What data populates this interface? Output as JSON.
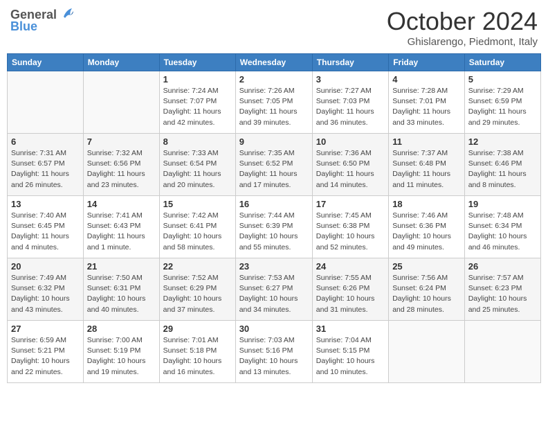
{
  "header": {
    "logo_general": "General",
    "logo_blue": "Blue",
    "month_title": "October 2024",
    "location": "Ghislarengo, Piedmont, Italy"
  },
  "weekdays": [
    "Sunday",
    "Monday",
    "Tuesday",
    "Wednesday",
    "Thursday",
    "Friday",
    "Saturday"
  ],
  "weeks": [
    [
      {
        "day": "",
        "info": ""
      },
      {
        "day": "",
        "info": ""
      },
      {
        "day": "1",
        "info": "Sunrise: 7:24 AM\nSunset: 7:07 PM\nDaylight: 11 hours and 42 minutes."
      },
      {
        "day": "2",
        "info": "Sunrise: 7:26 AM\nSunset: 7:05 PM\nDaylight: 11 hours and 39 minutes."
      },
      {
        "day": "3",
        "info": "Sunrise: 7:27 AM\nSunset: 7:03 PM\nDaylight: 11 hours and 36 minutes."
      },
      {
        "day": "4",
        "info": "Sunrise: 7:28 AM\nSunset: 7:01 PM\nDaylight: 11 hours and 33 minutes."
      },
      {
        "day": "5",
        "info": "Sunrise: 7:29 AM\nSunset: 6:59 PM\nDaylight: 11 hours and 29 minutes."
      }
    ],
    [
      {
        "day": "6",
        "info": "Sunrise: 7:31 AM\nSunset: 6:57 PM\nDaylight: 11 hours and 26 minutes."
      },
      {
        "day": "7",
        "info": "Sunrise: 7:32 AM\nSunset: 6:56 PM\nDaylight: 11 hours and 23 minutes."
      },
      {
        "day": "8",
        "info": "Sunrise: 7:33 AM\nSunset: 6:54 PM\nDaylight: 11 hours and 20 minutes."
      },
      {
        "day": "9",
        "info": "Sunrise: 7:35 AM\nSunset: 6:52 PM\nDaylight: 11 hours and 17 minutes."
      },
      {
        "day": "10",
        "info": "Sunrise: 7:36 AM\nSunset: 6:50 PM\nDaylight: 11 hours and 14 minutes."
      },
      {
        "day": "11",
        "info": "Sunrise: 7:37 AM\nSunset: 6:48 PM\nDaylight: 11 hours and 11 minutes."
      },
      {
        "day": "12",
        "info": "Sunrise: 7:38 AM\nSunset: 6:46 PM\nDaylight: 11 hours and 8 minutes."
      }
    ],
    [
      {
        "day": "13",
        "info": "Sunrise: 7:40 AM\nSunset: 6:45 PM\nDaylight: 11 hours and 4 minutes."
      },
      {
        "day": "14",
        "info": "Sunrise: 7:41 AM\nSunset: 6:43 PM\nDaylight: 11 hours and 1 minute."
      },
      {
        "day": "15",
        "info": "Sunrise: 7:42 AM\nSunset: 6:41 PM\nDaylight: 10 hours and 58 minutes."
      },
      {
        "day": "16",
        "info": "Sunrise: 7:44 AM\nSunset: 6:39 PM\nDaylight: 10 hours and 55 minutes."
      },
      {
        "day": "17",
        "info": "Sunrise: 7:45 AM\nSunset: 6:38 PM\nDaylight: 10 hours and 52 minutes."
      },
      {
        "day": "18",
        "info": "Sunrise: 7:46 AM\nSunset: 6:36 PM\nDaylight: 10 hours and 49 minutes."
      },
      {
        "day": "19",
        "info": "Sunrise: 7:48 AM\nSunset: 6:34 PM\nDaylight: 10 hours and 46 minutes."
      }
    ],
    [
      {
        "day": "20",
        "info": "Sunrise: 7:49 AM\nSunset: 6:32 PM\nDaylight: 10 hours and 43 minutes."
      },
      {
        "day": "21",
        "info": "Sunrise: 7:50 AM\nSunset: 6:31 PM\nDaylight: 10 hours and 40 minutes."
      },
      {
        "day": "22",
        "info": "Sunrise: 7:52 AM\nSunset: 6:29 PM\nDaylight: 10 hours and 37 minutes."
      },
      {
        "day": "23",
        "info": "Sunrise: 7:53 AM\nSunset: 6:27 PM\nDaylight: 10 hours and 34 minutes."
      },
      {
        "day": "24",
        "info": "Sunrise: 7:55 AM\nSunset: 6:26 PM\nDaylight: 10 hours and 31 minutes."
      },
      {
        "day": "25",
        "info": "Sunrise: 7:56 AM\nSunset: 6:24 PM\nDaylight: 10 hours and 28 minutes."
      },
      {
        "day": "26",
        "info": "Sunrise: 7:57 AM\nSunset: 6:23 PM\nDaylight: 10 hours and 25 minutes."
      }
    ],
    [
      {
        "day": "27",
        "info": "Sunrise: 6:59 AM\nSunset: 5:21 PM\nDaylight: 10 hours and 22 minutes."
      },
      {
        "day": "28",
        "info": "Sunrise: 7:00 AM\nSunset: 5:19 PM\nDaylight: 10 hours and 19 minutes."
      },
      {
        "day": "29",
        "info": "Sunrise: 7:01 AM\nSunset: 5:18 PM\nDaylight: 10 hours and 16 minutes."
      },
      {
        "day": "30",
        "info": "Sunrise: 7:03 AM\nSunset: 5:16 PM\nDaylight: 10 hours and 13 minutes."
      },
      {
        "day": "31",
        "info": "Sunrise: 7:04 AM\nSunset: 5:15 PM\nDaylight: 10 hours and 10 minutes."
      },
      {
        "day": "",
        "info": ""
      },
      {
        "day": "",
        "info": ""
      }
    ]
  ]
}
